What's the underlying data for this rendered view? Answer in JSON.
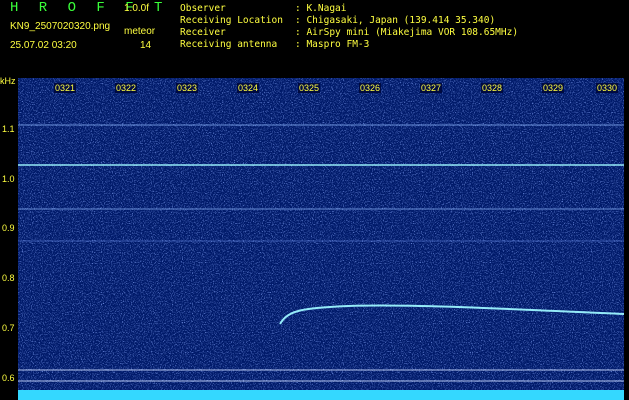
{
  "header": {
    "logo": "H R O F F T",
    "version": "1.0.0f",
    "filename": "KN9_2507020320.png",
    "timestamp": "25.07.02 03:20",
    "meteor_label": "meteor",
    "meteor_count": "14"
  },
  "meta": [
    {
      "key": "Observer",
      "value": ": K.Nagai"
    },
    {
      "key": "Receiving Location",
      "value": ": Chigasaki, Japan (139.414 35.340)"
    },
    {
      "key": "Receiver",
      "value": ": AirSpy mini (Miakejima VOR 108.65MHz)"
    },
    {
      "key": "Receiving antenna",
      "value": ": Maspro FM-3"
    }
  ],
  "y_axis": {
    "unit": "kHz",
    "ticks": [
      "1.1",
      "1.0",
      "0.9",
      "0.8",
      "0.7",
      "0.6"
    ]
  },
  "x_axis": {
    "ticks": [
      "0321",
      "0322",
      "0323",
      "0324",
      "0325",
      "0326",
      "0327",
      "0328",
      "0329",
      "0330"
    ]
  },
  "colors": {
    "background": "#001a6a",
    "noise": "#3a5cff",
    "signal": "#9cf6ff",
    "text": "#ffff40",
    "logo": "#3aff3a"
  }
}
